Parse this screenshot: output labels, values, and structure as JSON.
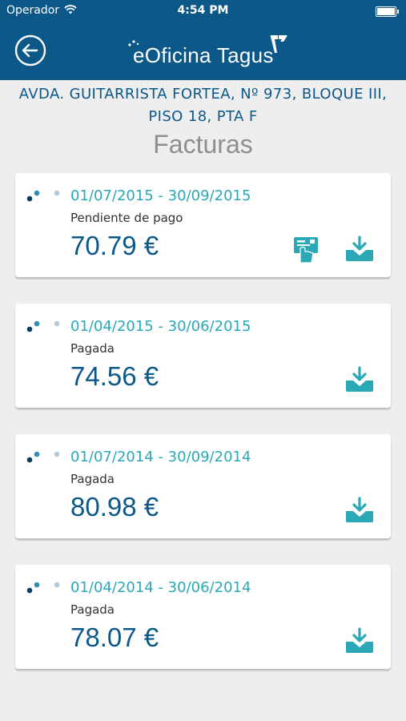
{
  "status_bar": {
    "carrier": "Operador",
    "time": "4:54 PM"
  },
  "header": {
    "logo_text": "eOficina Tagus",
    "back_icon": "back-arrow-circle-icon"
  },
  "address": {
    "line1": "AVDA. GUITARRISTA FORTEA, Nº 973, BLOQUE III,",
    "line2": "PISO 18, PTA F"
  },
  "page": {
    "title": "Facturas"
  },
  "invoices": [
    {
      "period": "01/07/2015 - 30/09/2015",
      "status": "Pendiente de pago",
      "amount": "70.79 €",
      "payable": true
    },
    {
      "period": "01/04/2015 - 30/06/2015",
      "status": "Pagada",
      "amount": "74.56 €",
      "payable": false
    },
    {
      "period": "01/07/2014 - 30/09/2014",
      "status": "Pagada",
      "amount": "80.98 €",
      "payable": false
    },
    {
      "period": "01/04/2014 - 30/06/2014",
      "status": "Pagada",
      "amount": "78.07 €",
      "payable": false
    }
  ],
  "colors": {
    "brand": "#0b5889",
    "accent": "#2aa8b6",
    "background": "#eeeeee"
  }
}
